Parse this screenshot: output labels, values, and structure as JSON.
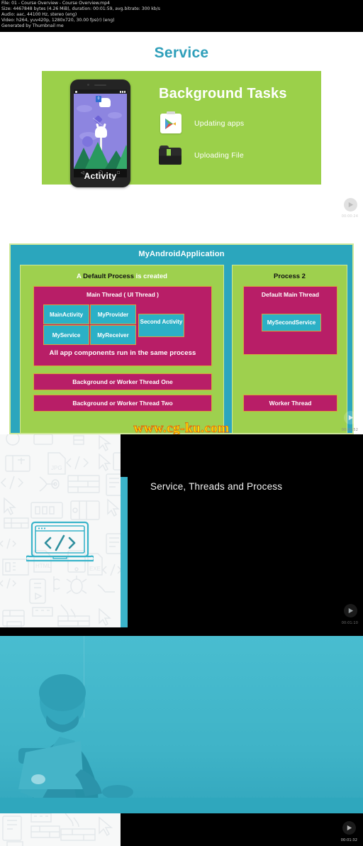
{
  "info": {
    "lines": [
      "File: 01 - Course Overview - Course Overview.mp4",
      "Size: 4467848 bytes (4.26 MiB), duration: 00:01:59, avg.bitrate: 300 kb/s",
      "Audio: aac, 44100 Hz, stereo (eng)",
      "Video: h264, yuv420p, 1280x720, 30.00 fps(r) (eng)",
      "Generated by Thumbnail me"
    ]
  },
  "panels": [
    {
      "name": "service-background-tasks",
      "timestamp": "00:00:24",
      "title": "Service",
      "heading": "Background Tasks",
      "phone_label": "Activity",
      "notification_badge": "0",
      "tasks": [
        {
          "icon": "play-store-icon",
          "label": "Updating apps"
        },
        {
          "icon": "download-folder-icon",
          "label": "Uploading File"
        }
      ]
    },
    {
      "name": "process-thread-diagram",
      "timestamp": "00:00:52",
      "watermark": "www.cg-ku.com",
      "app_title": "MyAndroidApplication",
      "left_process": {
        "title_prefix": "A ",
        "title_emphasis": "Default Process",
        "title_suffix": " is created",
        "main_thread": "Main Thread ( UI Thread )",
        "components": [
          "MainActivity",
          "MyProvider",
          "MyService",
          "MyReceiver"
        ],
        "second_activity": "Second Activity",
        "note": "All app components run in the same process",
        "worker_threads": [
          "Background or Worker Thread One",
          "Background or Worker Thread Two"
        ]
      },
      "right_process": {
        "title": "Process 2",
        "main_thread": "Default Main Thread",
        "service": "MySecondService",
        "worker_thread": "Worker Thread"
      }
    },
    {
      "name": "title-card",
      "timestamp": "00:01:10",
      "caption": "Service, Threads and Process",
      "pattern_labels": [
        "CSS",
        "JPG",
        "HTML",
        "EXE"
      ]
    },
    {
      "name": "instructor-video",
      "timestamp": "00:01:32"
    }
  ],
  "colors": {
    "teal": "#2ba6bd",
    "green": "#9ed04e",
    "magenta": "#b81e67",
    "cyan_box": "#2bb0c6",
    "title_teal": "#2f9fba",
    "watermark_yellow": "#ffe800"
  }
}
